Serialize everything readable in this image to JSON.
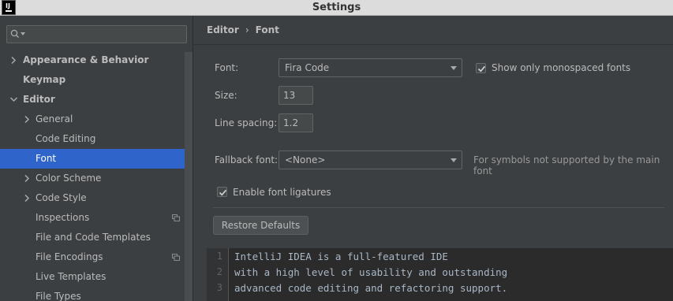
{
  "window": {
    "title": "Settings"
  },
  "search": {
    "placeholder": ""
  },
  "sidebar": {
    "items": [
      {
        "label": "Appearance & Behavior",
        "chevron": "right"
      },
      {
        "label": "Keymap",
        "chevron": "none"
      },
      {
        "label": "Editor",
        "chevron": "down"
      },
      {
        "label": "General",
        "chevron": "right"
      },
      {
        "label": "Code Editing",
        "chevron": "none"
      },
      {
        "label": "Font",
        "chevron": "none",
        "selected": true
      },
      {
        "label": "Color Scheme",
        "chevron": "right"
      },
      {
        "label": "Code Style",
        "chevron": "right"
      },
      {
        "label": "Inspections",
        "chevron": "none",
        "icon": "copy-icon"
      },
      {
        "label": "File and Code Templates",
        "chevron": "none"
      },
      {
        "label": "File Encodings",
        "chevron": "none",
        "icon": "copy-icon"
      },
      {
        "label": "Live Templates",
        "chevron": "none"
      },
      {
        "label": "File Types",
        "chevron": "none"
      }
    ]
  },
  "breadcrumb": {
    "parent": "Editor",
    "separator": "›",
    "current": "Font"
  },
  "form": {
    "font_label": "Font:",
    "font_value": "Fira Code",
    "mono_label": "Show only monospaced fonts",
    "mono_checked": true,
    "size_label": "Size:",
    "size_value": "13",
    "spacing_label": "Line spacing:",
    "spacing_value": "1.2",
    "fallback_label": "Fallback font:",
    "fallback_value": "<None>",
    "fallback_hint": "For symbols not supported by the main font",
    "ligatures_label": "Enable font ligatures",
    "ligatures_checked": true,
    "restore_label": "Restore Defaults"
  },
  "preview": {
    "lines": [
      {
        "n": "1",
        "text": "IntelliJ IDEA is a full-featured IDE"
      },
      {
        "n": "2",
        "text": "with a high level of usability and outstanding"
      },
      {
        "n": "3",
        "text": "advanced code editing and refactoring support."
      }
    ]
  },
  "colors": {
    "background": "#3c3f41",
    "selection": "#2f65ca",
    "editor_bg": "#2b2b2b",
    "text": "#bbbbbb"
  }
}
